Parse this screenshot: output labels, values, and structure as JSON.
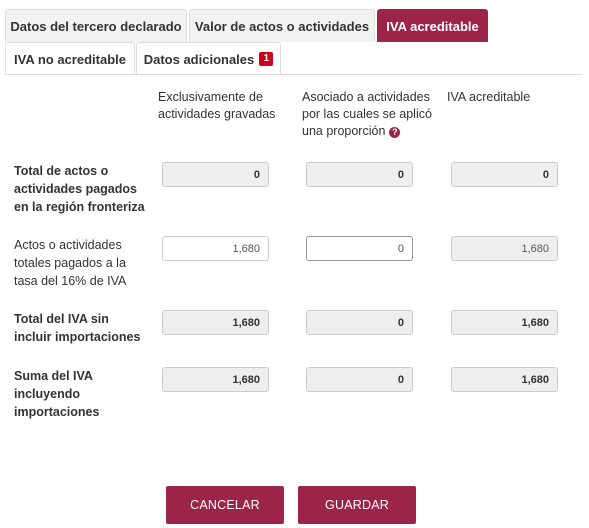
{
  "tabs": [
    {
      "label": "Datos del tercero declarado"
    },
    {
      "label": "Valor de actos o actividades"
    },
    {
      "label": "IVA acreditable"
    },
    {
      "label": "IVA no acreditable"
    },
    {
      "label": "Datos adicionales",
      "badge": "1"
    }
  ],
  "active_tab": "IVA acreditable",
  "columns": [
    {
      "line1": "Exclusivamente de",
      "line2": "actividades gravadas"
    },
    {
      "line1": "Asociado a actividades",
      "line2": "por las cuales se aplicó",
      "line3": "una proporción"
    },
    {
      "line1": "IVA acreditable"
    }
  ],
  "rows": [
    {
      "label_lines": [
        "Total de actos o",
        "actividades pagados",
        "en la región fronteriza"
      ],
      "values": [
        "0",
        "0",
        "0"
      ]
    },
    {
      "label_lines": [
        "Actos o actividades",
        "totales pagados a la",
        "tasa del 16% de IVA"
      ],
      "values": [
        "1,680",
        "0",
        "1,680"
      ]
    },
    {
      "label_lines": [
        "Total del IVA sin",
        "incluir importaciones"
      ],
      "values": [
        "1,680",
        "0",
        "1,680"
      ]
    },
    {
      "label_lines": [
        "Suma del IVA",
        "incluyendo",
        "importaciones"
      ],
      "values": [
        "1,680",
        "0",
        "1,680"
      ]
    }
  ],
  "buttons": {
    "cancel": "CANCELAR",
    "save": "GUARDAR"
  },
  "colors": {
    "accent": "#9d2449",
    "badge": "#d0021b"
  },
  "icons": {
    "help": "question-circle-icon"
  }
}
